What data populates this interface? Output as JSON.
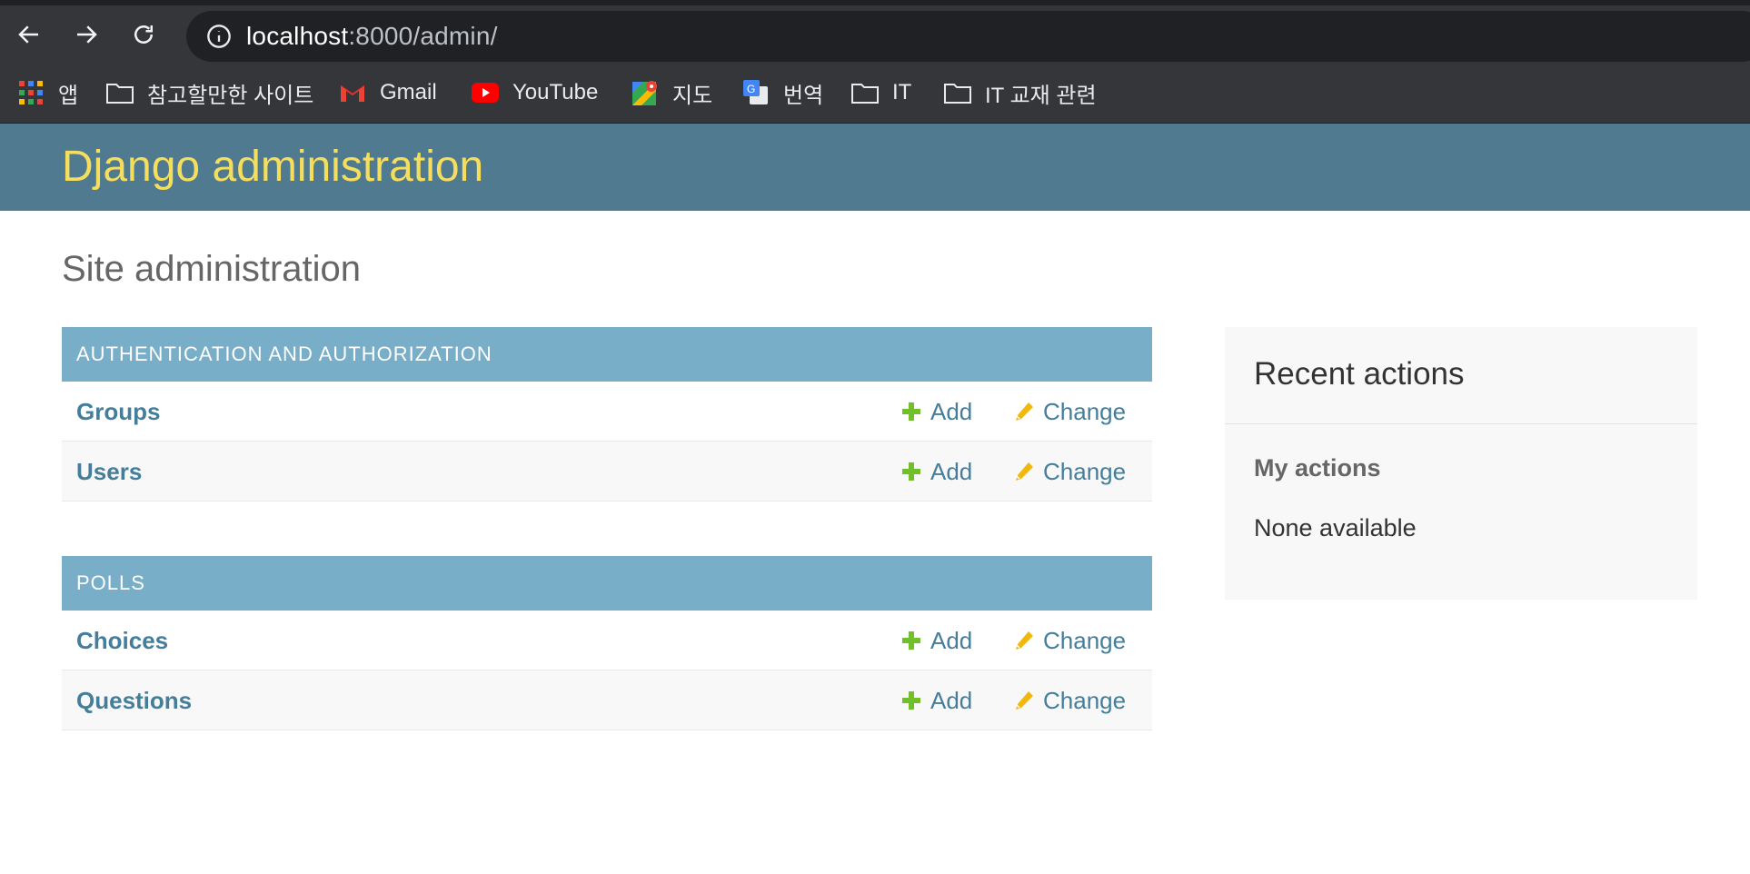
{
  "browser": {
    "url_host": "localhost",
    "url_rest": ":8000/admin/",
    "bookmarks": [
      {
        "label": "앱",
        "icon": "apps-grid-icon"
      },
      {
        "label": "참고할만한 사이트",
        "icon": "folder-icon"
      },
      {
        "label": "Gmail",
        "icon": "gmail-icon"
      },
      {
        "label": "YouTube",
        "icon": "youtube-icon"
      },
      {
        "label": "지도",
        "icon": "maps-icon"
      },
      {
        "label": "번역",
        "icon": "translate-icon"
      },
      {
        "label": "IT",
        "icon": "folder-icon"
      },
      {
        "label": "IT 교재 관련",
        "icon": "folder-icon"
      }
    ]
  },
  "header": {
    "branding": "Django administration"
  },
  "main": {
    "title": "Site administration",
    "apps": [
      {
        "caption": "AUTHENTICATION AND AUTHORIZATION",
        "models": [
          {
            "name": "Groups",
            "add": "Add",
            "change": "Change"
          },
          {
            "name": "Users",
            "add": "Add",
            "change": "Change"
          }
        ]
      },
      {
        "caption": "POLLS",
        "models": [
          {
            "name": "Choices",
            "add": "Add",
            "change": "Change"
          },
          {
            "name": "Questions",
            "add": "Add",
            "change": "Change"
          }
        ]
      }
    ]
  },
  "sidebar": {
    "title": "Recent actions",
    "subtitle": "My actions",
    "empty": "None available"
  },
  "colors": {
    "header_bg": "#4f7a8f",
    "branding": "#f5dd5d",
    "caption_bg": "#79aec8",
    "link": "#447e9b",
    "add_icon": "#70bf2b",
    "change_icon": "#efb80b"
  }
}
